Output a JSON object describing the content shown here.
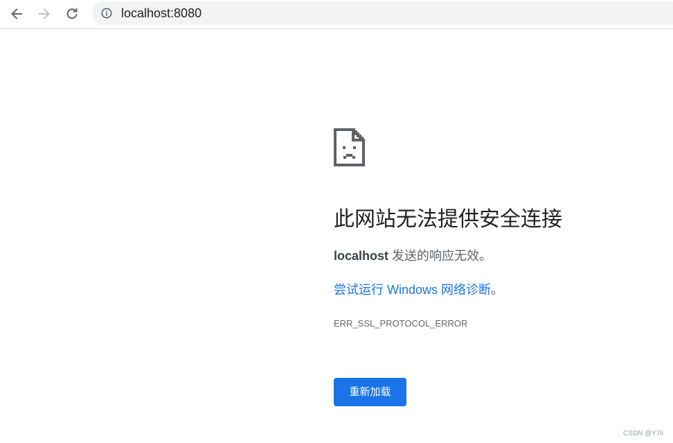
{
  "browser": {
    "back_icon": "arrow-left-icon",
    "forward_icon": "arrow-right-icon",
    "reload_icon": "reload-icon",
    "info_icon": "info-circle-icon",
    "url": "localhost:8080"
  },
  "error_page": {
    "icon": "sad-page-icon",
    "title": "此网站无法提供安全连接",
    "summary_host": "localhost",
    "summary_text": " 发送的响应无效。",
    "suggestion_link": "尝试运行 Windows 网络诊断",
    "suggestion_suffix": "。",
    "error_code": "ERR_SSL_PROTOCOL_ERROR",
    "reload_button": "重新加载"
  },
  "watermark": "CSDN @Y7ii",
  "colors": {
    "accent": "#1a73e8",
    "text_primary": "#202124",
    "text_secondary": "#5f6368",
    "omnibox_bg": "#f1f3f4"
  }
}
